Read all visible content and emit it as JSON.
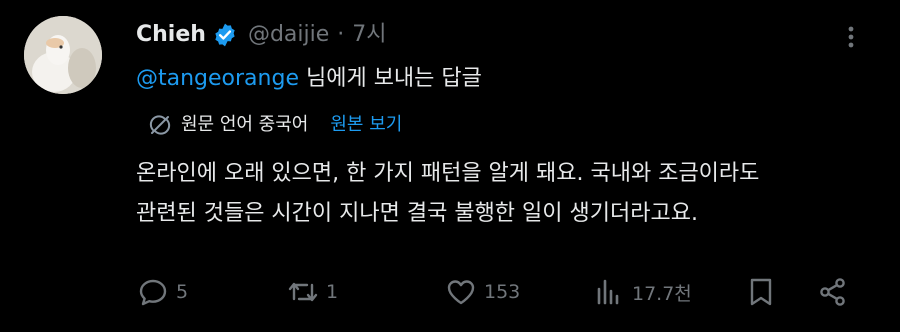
{
  "tweet": {
    "display_name": "Chieh",
    "handle": "@daijie",
    "separator": "·",
    "time": "7시",
    "reply_mention": "@tangeorange",
    "reply_suffix": " 님에게 보내는 답글",
    "translate_label": "원문 언어 중국어",
    "show_original": "원본 보기",
    "text_line1": "온라인에 오래 있으면, 한 가지 패턴을 알게 돼요. 국내와 조금이라도",
    "text_line2": "관련된 것들은 시간이 지나면 결국 불행한 일이 생기더라고요."
  },
  "actions": {
    "reply_count": "5",
    "retweet_count": "1",
    "like_count": "153",
    "views_count": "17.7천"
  },
  "colors": {
    "background": "#000000",
    "text": "#e7e9ea",
    "muted": "#71767b",
    "accent": "#1d9bf0"
  },
  "icons": [
    "avatar",
    "verified-badge-icon",
    "more-icon",
    "translate-icon",
    "reply-icon",
    "retweet-icon",
    "like-icon",
    "views-icon",
    "bookmark-icon",
    "share-icon"
  ]
}
